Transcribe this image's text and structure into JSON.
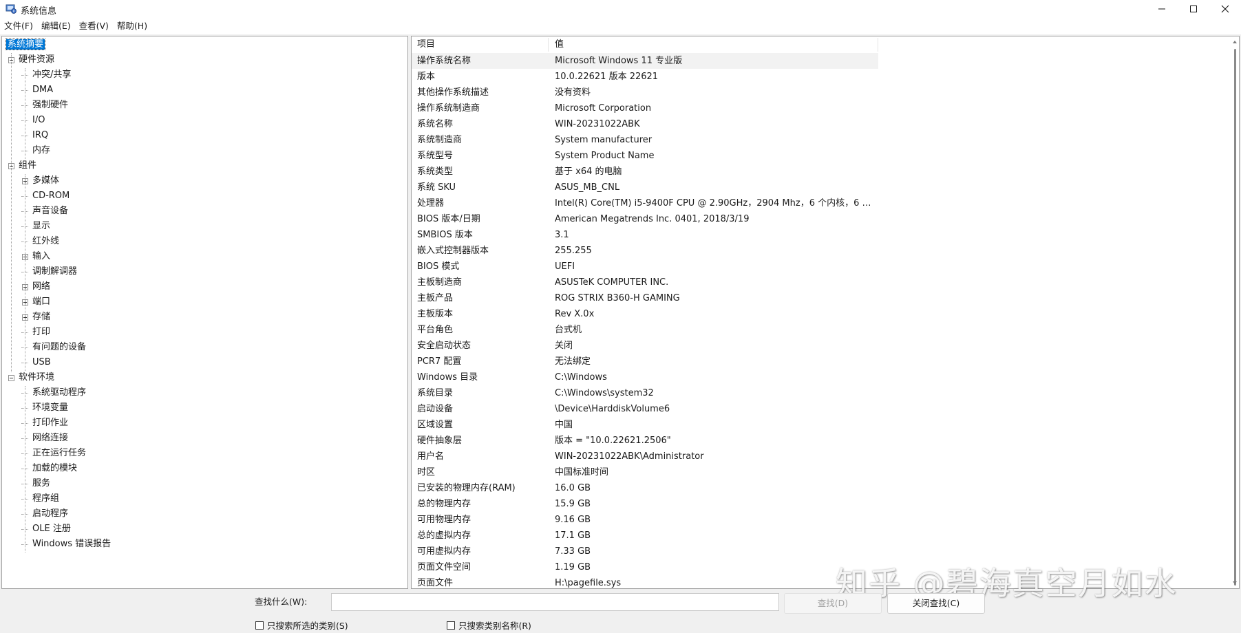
{
  "window": {
    "title": "系统信息"
  },
  "menu": [
    "文件(F)",
    "编辑(E)",
    "查看(V)",
    "帮助(H)"
  ],
  "tree": [
    {
      "label": "系统摘要",
      "depth": 0,
      "selected": true,
      "expander": "none"
    },
    {
      "label": "硬件资源",
      "depth": 1,
      "expander": "minus"
    },
    {
      "label": "冲突/共享",
      "depth": 2,
      "expander": "none"
    },
    {
      "label": "DMA",
      "depth": 2,
      "expander": "none"
    },
    {
      "label": "强制硬件",
      "depth": 2,
      "expander": "none"
    },
    {
      "label": "I/O",
      "depth": 2,
      "expander": "none"
    },
    {
      "label": "IRQ",
      "depth": 2,
      "expander": "none"
    },
    {
      "label": "内存",
      "depth": 2,
      "expander": "none"
    },
    {
      "label": "组件",
      "depth": 1,
      "expander": "minus"
    },
    {
      "label": "多媒体",
      "depth": 2,
      "expander": "plus"
    },
    {
      "label": "CD-ROM",
      "depth": 2,
      "expander": "none"
    },
    {
      "label": "声音设备",
      "depth": 2,
      "expander": "none"
    },
    {
      "label": "显示",
      "depth": 2,
      "expander": "none"
    },
    {
      "label": "红外线",
      "depth": 2,
      "expander": "none"
    },
    {
      "label": "输入",
      "depth": 2,
      "expander": "plus"
    },
    {
      "label": "调制解调器",
      "depth": 2,
      "expander": "none"
    },
    {
      "label": "网络",
      "depth": 2,
      "expander": "plus"
    },
    {
      "label": "端口",
      "depth": 2,
      "expander": "plus"
    },
    {
      "label": "存储",
      "depth": 2,
      "expander": "plus"
    },
    {
      "label": "打印",
      "depth": 2,
      "expander": "none"
    },
    {
      "label": "有问题的设备",
      "depth": 2,
      "expander": "none"
    },
    {
      "label": "USB",
      "depth": 2,
      "expander": "none"
    },
    {
      "label": "软件环境",
      "depth": 1,
      "expander": "minus"
    },
    {
      "label": "系统驱动程序",
      "depth": 2,
      "expander": "none"
    },
    {
      "label": "环境变量",
      "depth": 2,
      "expander": "none"
    },
    {
      "label": "打印作业",
      "depth": 2,
      "expander": "none"
    },
    {
      "label": "网络连接",
      "depth": 2,
      "expander": "none"
    },
    {
      "label": "正在运行任务",
      "depth": 2,
      "expander": "none"
    },
    {
      "label": "加载的模块",
      "depth": 2,
      "expander": "none"
    },
    {
      "label": "服务",
      "depth": 2,
      "expander": "none"
    },
    {
      "label": "程序组",
      "depth": 2,
      "expander": "none"
    },
    {
      "label": "启动程序",
      "depth": 2,
      "expander": "none"
    },
    {
      "label": "OLE 注册",
      "depth": 2,
      "expander": "none"
    },
    {
      "label": "Windows 错误报告",
      "depth": 2,
      "expander": "none"
    }
  ],
  "table": {
    "headers": [
      "项目",
      "值"
    ],
    "rows": [
      [
        "操作系统名称",
        "Microsoft Windows 11 专业版"
      ],
      [
        "版本",
        "10.0.22621 版本 22621"
      ],
      [
        "其他操作系统描述",
        "没有资料"
      ],
      [
        "操作系统制造商",
        "Microsoft Corporation"
      ],
      [
        "系统名称",
        "WIN-20231022ABK"
      ],
      [
        "系统制造商",
        "System manufacturer"
      ],
      [
        "系统型号",
        "System Product Name"
      ],
      [
        "系统类型",
        "基于 x64 的电脑"
      ],
      [
        "系统 SKU",
        "ASUS_MB_CNL"
      ],
      [
        "处理器",
        "Intel(R) Core(TM) i5-9400F CPU @ 2.90GHz，2904 Mhz，6 个内核，6 个..."
      ],
      [
        "BIOS 版本/日期",
        "American Megatrends Inc. 0401, 2018/3/19"
      ],
      [
        "SMBIOS 版本",
        "3.1"
      ],
      [
        "嵌入式控制器版本",
        "255.255"
      ],
      [
        "BIOS 模式",
        "UEFI"
      ],
      [
        "主板制造商",
        "ASUSTeK COMPUTER INC."
      ],
      [
        "主板产品",
        "ROG STRIX B360-H GAMING"
      ],
      [
        "主板版本",
        "Rev X.0x"
      ],
      [
        "平台角色",
        "台式机"
      ],
      [
        "安全启动状态",
        "关闭"
      ],
      [
        "PCR7 配置",
        "无法绑定"
      ],
      [
        "Windows 目录",
        "C:\\Windows"
      ],
      [
        "系统目录",
        "C:\\Windows\\system32"
      ],
      [
        "启动设备",
        "\\Device\\HarddiskVolume6"
      ],
      [
        "区域设置",
        "中国"
      ],
      [
        "硬件抽象层",
        "版本 = \"10.0.22621.2506\""
      ],
      [
        "用户名",
        "WIN-20231022ABK\\Administrator"
      ],
      [
        "时区",
        "中国标准时间"
      ],
      [
        "已安装的物理内存(RAM)",
        "16.0 GB"
      ],
      [
        "总的物理内存",
        "15.9 GB"
      ],
      [
        "可用物理内存",
        "9.16 GB"
      ],
      [
        "总的虚拟内存",
        "17.1 GB"
      ],
      [
        "可用虚拟内存",
        "7.33 GB"
      ],
      [
        "页面文件空间",
        "1.19 GB"
      ],
      [
        "页面文件",
        "H:\\pagefile.sys"
      ]
    ]
  },
  "find": {
    "label": "查找什么(W):",
    "value": "",
    "find_button": "查找(D)",
    "close_find_button": "关闭查找(C)",
    "option1": "只搜索所选的类别(S)",
    "option2": "只搜索类别名称(R)"
  },
  "watermark": "知乎 @碧海真空月如水",
  "colors": {
    "selection": "#0078d7",
    "window_bg": "#f0f0f0"
  }
}
